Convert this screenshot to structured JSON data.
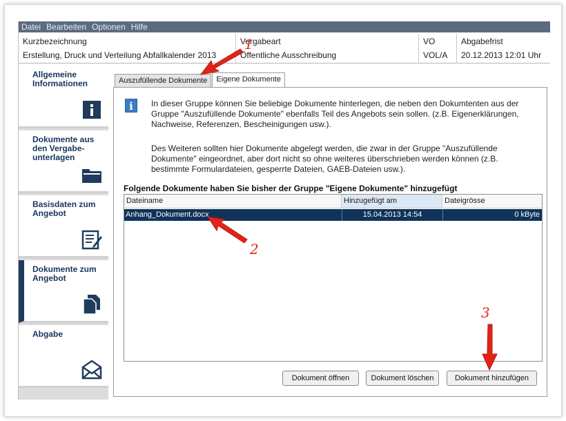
{
  "menu": [
    "Datei",
    "Bearbeiten",
    "Optionen",
    "Hilfe"
  ],
  "header": {
    "kurz_label": "Kurzbezeichnung",
    "kurz_value": "Erstellung, Druck und Verteilung Abfallkalender 2013",
    "art_label": "Vergabeart",
    "art_value": "Öffentliche Ausschreibung",
    "vo_label": "VO",
    "vo_value": "VOL/A",
    "frist_label": "Abgabefrist",
    "frist_value": "20.12.2013 12:01 Uhr"
  },
  "sidebar": {
    "items": [
      {
        "label": "Allgemeine Informationen",
        "icon": "info-icon"
      },
      {
        "label": "Dokumente aus den Vergabe-unterlagen",
        "icon": "folder-icon"
      },
      {
        "label": "Basisdaten zum Angebot",
        "icon": "edit-form-icon"
      },
      {
        "label": "Dokumente zum Angebot",
        "icon": "documents-icon"
      },
      {
        "label": "Abgabe",
        "icon": "envelope-icon"
      }
    ],
    "active_index": 3
  },
  "tabs": [
    "Auszufüllende Dokumente",
    "Eigene Dokumente"
  ],
  "info": {
    "p1": "In dieser Gruppe können Sie beliebige Dokumente hinterlegen, die neben den Dokumtenten aus der Gruppe \"Auszufüllende Dokumente\" ebenfalls Teil des Angebots sein sollen. (z.B. Eigenerklärungen, Nachweise, Referenzen, Bescheinigungen usw.).",
    "p2": "Des Weiteren sollten hier Dokumente abgelegt werden, die zwar in der Gruppe \"Auszufüllende Dokumente\" eingeordnet, aber dort nicht so ohne weiteres überschrieben werden können (z.B. bestimmte Formulardateien, gesperrte Dateien, GAEB-Dateien usw.)."
  },
  "section_title": "Folgende Dokumente haben Sie bisher der Gruppe \"Eigene Dokumente\" hinzugefügt",
  "table": {
    "columns": [
      "Dateiname",
      "Hinzugefügt am",
      "Dateigrösse"
    ],
    "rows": [
      {
        "name": "Anhang_Dokument.docx",
        "date": "15.04.2013 14:54",
        "size": "0 kByte"
      }
    ]
  },
  "buttons": {
    "open": "Dokument öffnen",
    "delete": "Dokument löschen",
    "add": "Dokument hinzufügen"
  },
  "annotations": [
    "1",
    "2",
    "3"
  ],
  "colors": {
    "accent": "#1f3c5c",
    "selection": "#10335a",
    "annotation": "#e2231a",
    "menubar": "#5c6c80"
  }
}
